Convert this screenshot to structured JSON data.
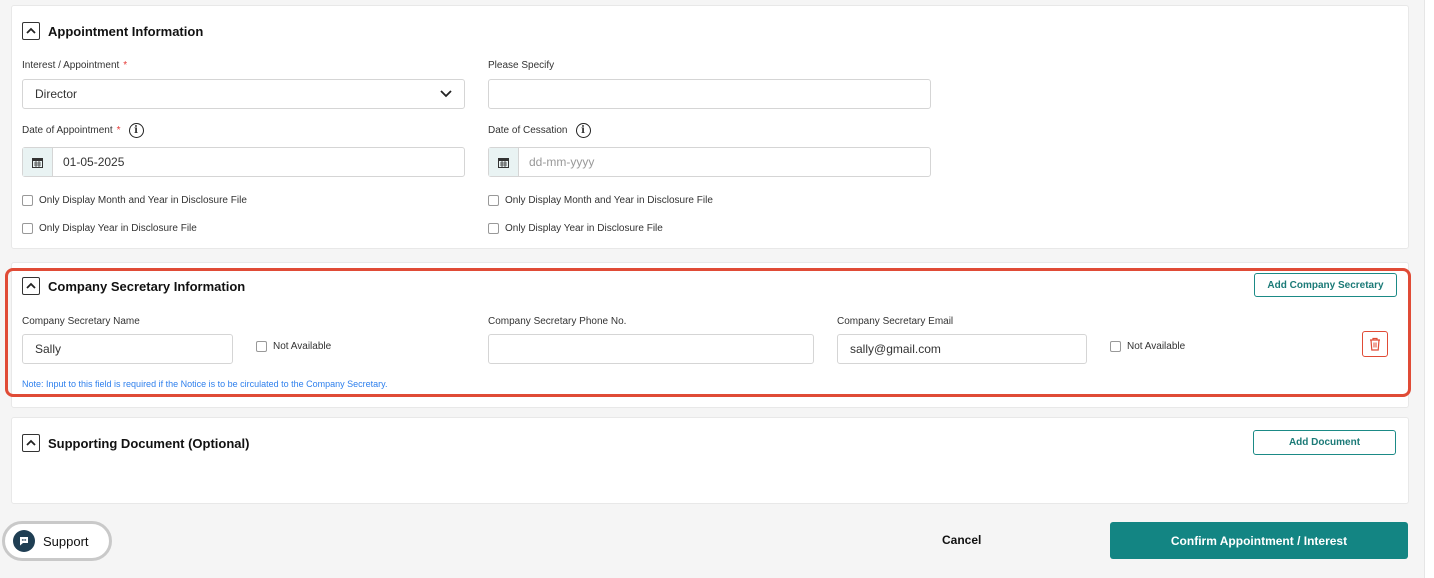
{
  "appointment": {
    "title": "Appointment Information",
    "interest_label": "Interest / Appointment",
    "interest_value": "Director",
    "please_specify_label": "Please Specify",
    "please_specify_value": "",
    "date_appointment_label": "Date of Appointment",
    "date_appointment_value": "01-05-2025",
    "date_cessation_label": "Date of Cessation",
    "date_cessation_placeholder": "dd-mm-yyyy",
    "chk_month_year": "Only Display Month and Year in Disclosure File",
    "chk_year": "Only Display Year in Disclosure File",
    "required_mark": "*",
    "info_glyph": "i"
  },
  "secretary": {
    "title": "Company Secretary Information",
    "add_button": "Add Company Secretary",
    "name_label": "Company Secretary Name",
    "name_value": "Sally",
    "not_available": "Not Available",
    "phone_label": "Company Secretary Phone No.",
    "phone_value": "",
    "email_label": "Company Secretary Email",
    "email_value": "sally@gmail.com",
    "note": "Note: Input to this field is required if the Notice is to be circulated to the Company Secretary."
  },
  "supporting": {
    "title": "Supporting Document (Optional)",
    "add_button": "Add Document"
  },
  "footer": {
    "support": "Support",
    "cancel": "Cancel",
    "confirm": "Confirm Appointment / Interest"
  },
  "icons": {
    "toggle": "chevron-up-icon",
    "calendar": "calendar-icon",
    "info": "info-icon",
    "trash": "trash-icon",
    "support": "chat-icon",
    "select": "chevron-down-icon"
  },
  "colors": {
    "accent": "#138583",
    "highlight": "#e04b36",
    "note": "#2f80ed",
    "required": "#e53935"
  }
}
